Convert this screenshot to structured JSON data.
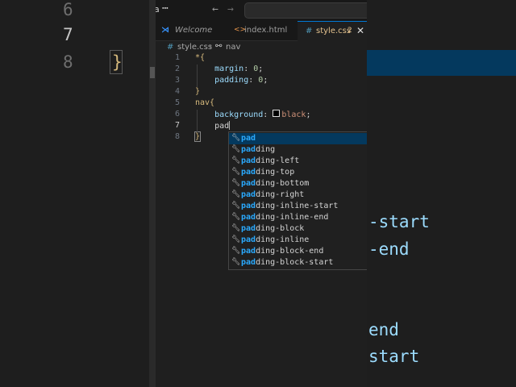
{
  "backdrop": {
    "left_lines": [
      {
        "num": "6",
        "text": ""
      },
      {
        "num": "7",
        "text": ""
      },
      {
        "num": "8",
        "text": "}"
      }
    ],
    "right_lines": [
      {
        "text": "-start"
      },
      {
        "text": "-end"
      },
      {
        "text": "end"
      },
      {
        "text": "start"
      }
    ]
  },
  "titlebar": {
    "app_letter": "a",
    "more_icon": "ellipsis-icon",
    "back_icon": "arrow-left-icon",
    "forward_icon": "arrow-right-icon"
  },
  "tabs": [
    {
      "label": "Welcome",
      "icon": "vscode-icon",
      "active": false
    },
    {
      "label": "index.html",
      "icon": "html-icon",
      "active": false
    },
    {
      "label": "style.css",
      "icon": "css-hash-icon",
      "problems": "2",
      "active": true
    }
  ],
  "breadcrumb": {
    "file": "style.css",
    "symbol": "nav"
  },
  "code_lines": [
    {
      "num": "1",
      "tokens": [
        {
          "t": "*{",
          "c": "t-sel"
        }
      ]
    },
    {
      "num": "2",
      "tokens": [
        {
          "t": "    margin",
          "c": "t-prop"
        },
        {
          "t": ": ",
          "c": ""
        },
        {
          "t": "0",
          "c": "t-num"
        },
        {
          "t": ";",
          "c": ""
        }
      ]
    },
    {
      "num": "3",
      "tokens": [
        {
          "t": "    padding",
          "c": "t-prop"
        },
        {
          "t": ": ",
          "c": ""
        },
        {
          "t": "0",
          "c": "t-num"
        },
        {
          "t": ";",
          "c": ""
        }
      ]
    },
    {
      "num": "4",
      "tokens": [
        {
          "t": "}",
          "c": "t-sel"
        }
      ]
    },
    {
      "num": "5",
      "tokens": [
        {
          "t": "nav{",
          "c": "t-sel"
        }
      ]
    },
    {
      "num": "6",
      "tokens": [
        {
          "t": "    background",
          "c": "t-prop"
        },
        {
          "t": ": ",
          "c": ""
        },
        {
          "t": "SWATCH",
          "c": "swatch"
        },
        {
          "t": "black",
          "c": "t-val"
        },
        {
          "t": ";",
          "c": ""
        }
      ]
    },
    {
      "num": "7",
      "tokens": [
        {
          "t": "    pad",
          "c": ""
        },
        {
          "t": "CURSOR",
          "c": "cursor"
        }
      ]
    },
    {
      "num": "8",
      "tokens": [
        {
          "t": "}",
          "c": "t-sel bracket-hl"
        }
      ]
    }
  ],
  "suggestions": {
    "typed": "pad",
    "icon": "wrench-icon",
    "items": [
      "pad",
      "padding",
      "padding-left",
      "padding-top",
      "padding-bottom",
      "padding-right",
      "padding-inline-start",
      "padding-inline-end",
      "padding-block",
      "padding-inline",
      "padding-block-end",
      "padding-block-start"
    ],
    "selected_index": 0
  },
  "colors": {
    "accent": "#0078d4",
    "selection": "#04395e",
    "match_highlight": "#2aaaff"
  }
}
